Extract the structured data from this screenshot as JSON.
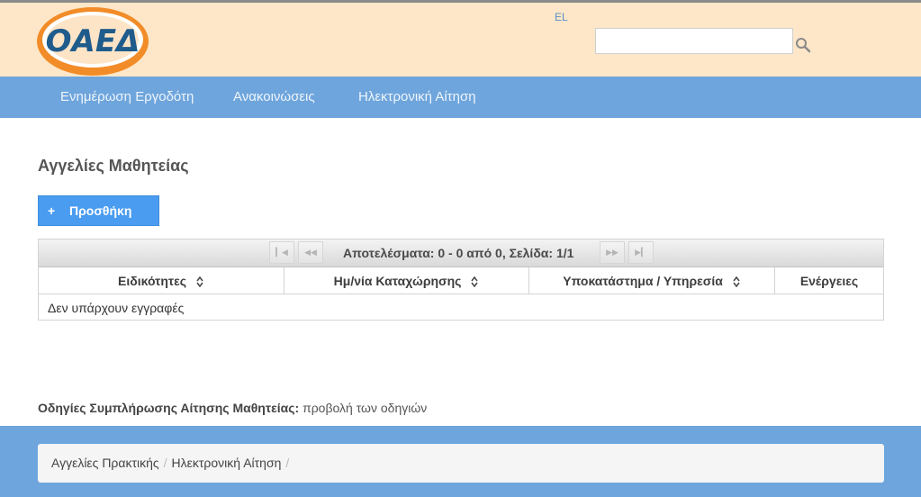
{
  "header": {
    "logo_text": "ΟΑΕΔ",
    "language": "EL",
    "search": {
      "value": "",
      "placeholder": ""
    }
  },
  "nav": {
    "items": [
      {
        "label": "Ενημέρωση Εργοδότη"
      },
      {
        "label": "Ανακοινώσεις"
      },
      {
        "label": "Ηλεκτρονική Αίτηση"
      }
    ]
  },
  "main": {
    "title": "Αγγελίες Μαθητείας",
    "add_button": {
      "icon": "+",
      "label": "Προσθήκη"
    },
    "grid": {
      "pager": {
        "first": "►|",
        "prev": "◄◄",
        "text": "Αποτελέσματα: 0 - 0 από 0, Σελίδα: 1/1",
        "next": "►►",
        "last": "►|"
      },
      "columns": [
        {
          "label": "Ειδικότητες"
        },
        {
          "label": "Ημ/νία Καταχώρησης"
        },
        {
          "label": "Υποκατάστημα / Υπηρεσία"
        },
        {
          "label": "Ενέργειες"
        }
      ],
      "empty_message": "Δεν υπάρχουν εγγραφές"
    },
    "instructions": {
      "label": "Οδηγίες Συμπλήρωσης Αίτησης Μαθητείας:",
      "link": "προβολή των οδηγιών"
    }
  },
  "footer": {
    "breadcrumb": [
      {
        "label": "Αγγελίες Πρακτικής"
      },
      {
        "label": "Ηλεκτρονική Αίτηση"
      }
    ],
    "separator": "/"
  },
  "colors": {
    "header_bg": "#fde7c8",
    "nav_bg": "#6ea5dc",
    "button_blue": "#4a9cf0",
    "logo_blue": "#1f5c8c",
    "logo_orange": "#f28c28"
  }
}
